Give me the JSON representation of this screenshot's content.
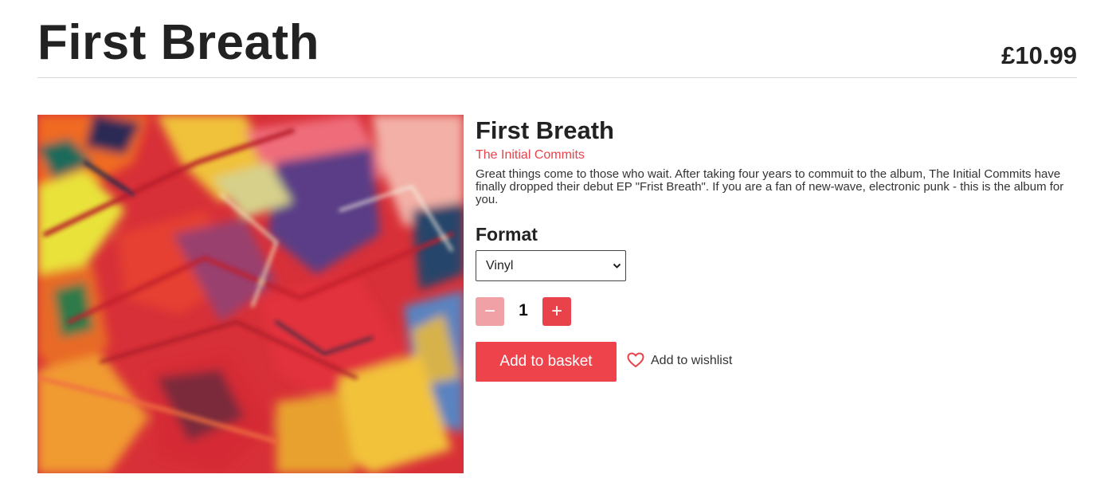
{
  "header": {
    "title": "First Breath",
    "price": "£10.99"
  },
  "product": {
    "title": "First Breath",
    "artist": "The Initial Commits",
    "description": "Great things come to those who wait. After taking four years to commuit to the album, The Initial Commits have finally dropped their debut EP \"Frist Breath\". If you are a fan of new-wave, electronic punk - this is the album for you.",
    "format_label": "Format",
    "format_selected": "Vinyl",
    "quantity": "1",
    "minus_symbol": "−",
    "plus_symbol": "+",
    "add_to_basket": "Add to basket",
    "add_to_wishlist": "Add to wishlist"
  },
  "icons": {
    "select_chevron": "chevron-down-icon",
    "wishlist": "heart-icon"
  },
  "colors": {
    "accent": "#ee434b",
    "accent_disabled": "#f0a1a5",
    "artist": "#e8424a",
    "text": "#222222"
  }
}
